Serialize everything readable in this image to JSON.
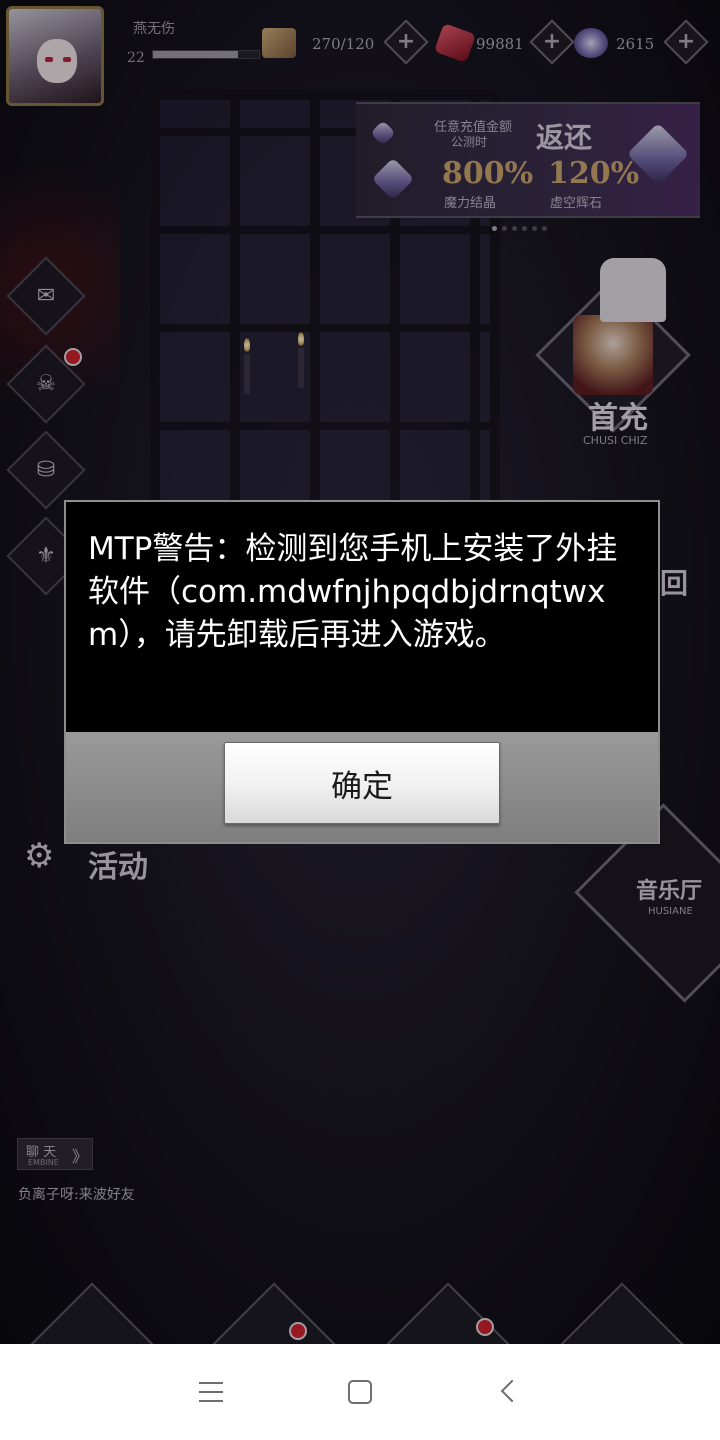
{
  "player": {
    "name": "燕无伤",
    "level": "22",
    "xp_fraction": 0.8
  },
  "resources": [
    {
      "icon": "stamina-cards-icon",
      "value": "270/120"
    },
    {
      "icon": "red-crystal-icon",
      "value": "99881"
    },
    {
      "icon": "purple-crystal-icon",
      "value": "2615"
    }
  ],
  "banner": {
    "line1": "任意充值金额",
    "line2": "公测时",
    "title": "返还",
    "pct1": "800%",
    "pct2": "120%",
    "label1": "魔力结晶",
    "label2": "虚空辉石",
    "page_index": 1,
    "page_count": 6
  },
  "first_charge": {
    "label": "首充",
    "sub": "CHUSI CHIZ"
  },
  "side_menu": {
    "back_label": "回",
    "activity_label": "活动"
  },
  "music_hall": {
    "label": "音乐厅",
    "sub": "HUSIANE"
  },
  "chat": {
    "tag": "聊 天",
    "tag_sub": "EMBINE",
    "arrow": "》",
    "message": "负离子呀:来波好友"
  },
  "dialog": {
    "message": "MTP警告：检测到您手机上安装了外挂软件（com.mdwfnjhpqdbjdrnqtwxm），请先卸载后再进入游戏。",
    "ok_label": "确定"
  },
  "colors": {
    "dialog_bg": "#000000",
    "dialog_footer": "#8c8c8c",
    "notification": "#c8202c"
  }
}
